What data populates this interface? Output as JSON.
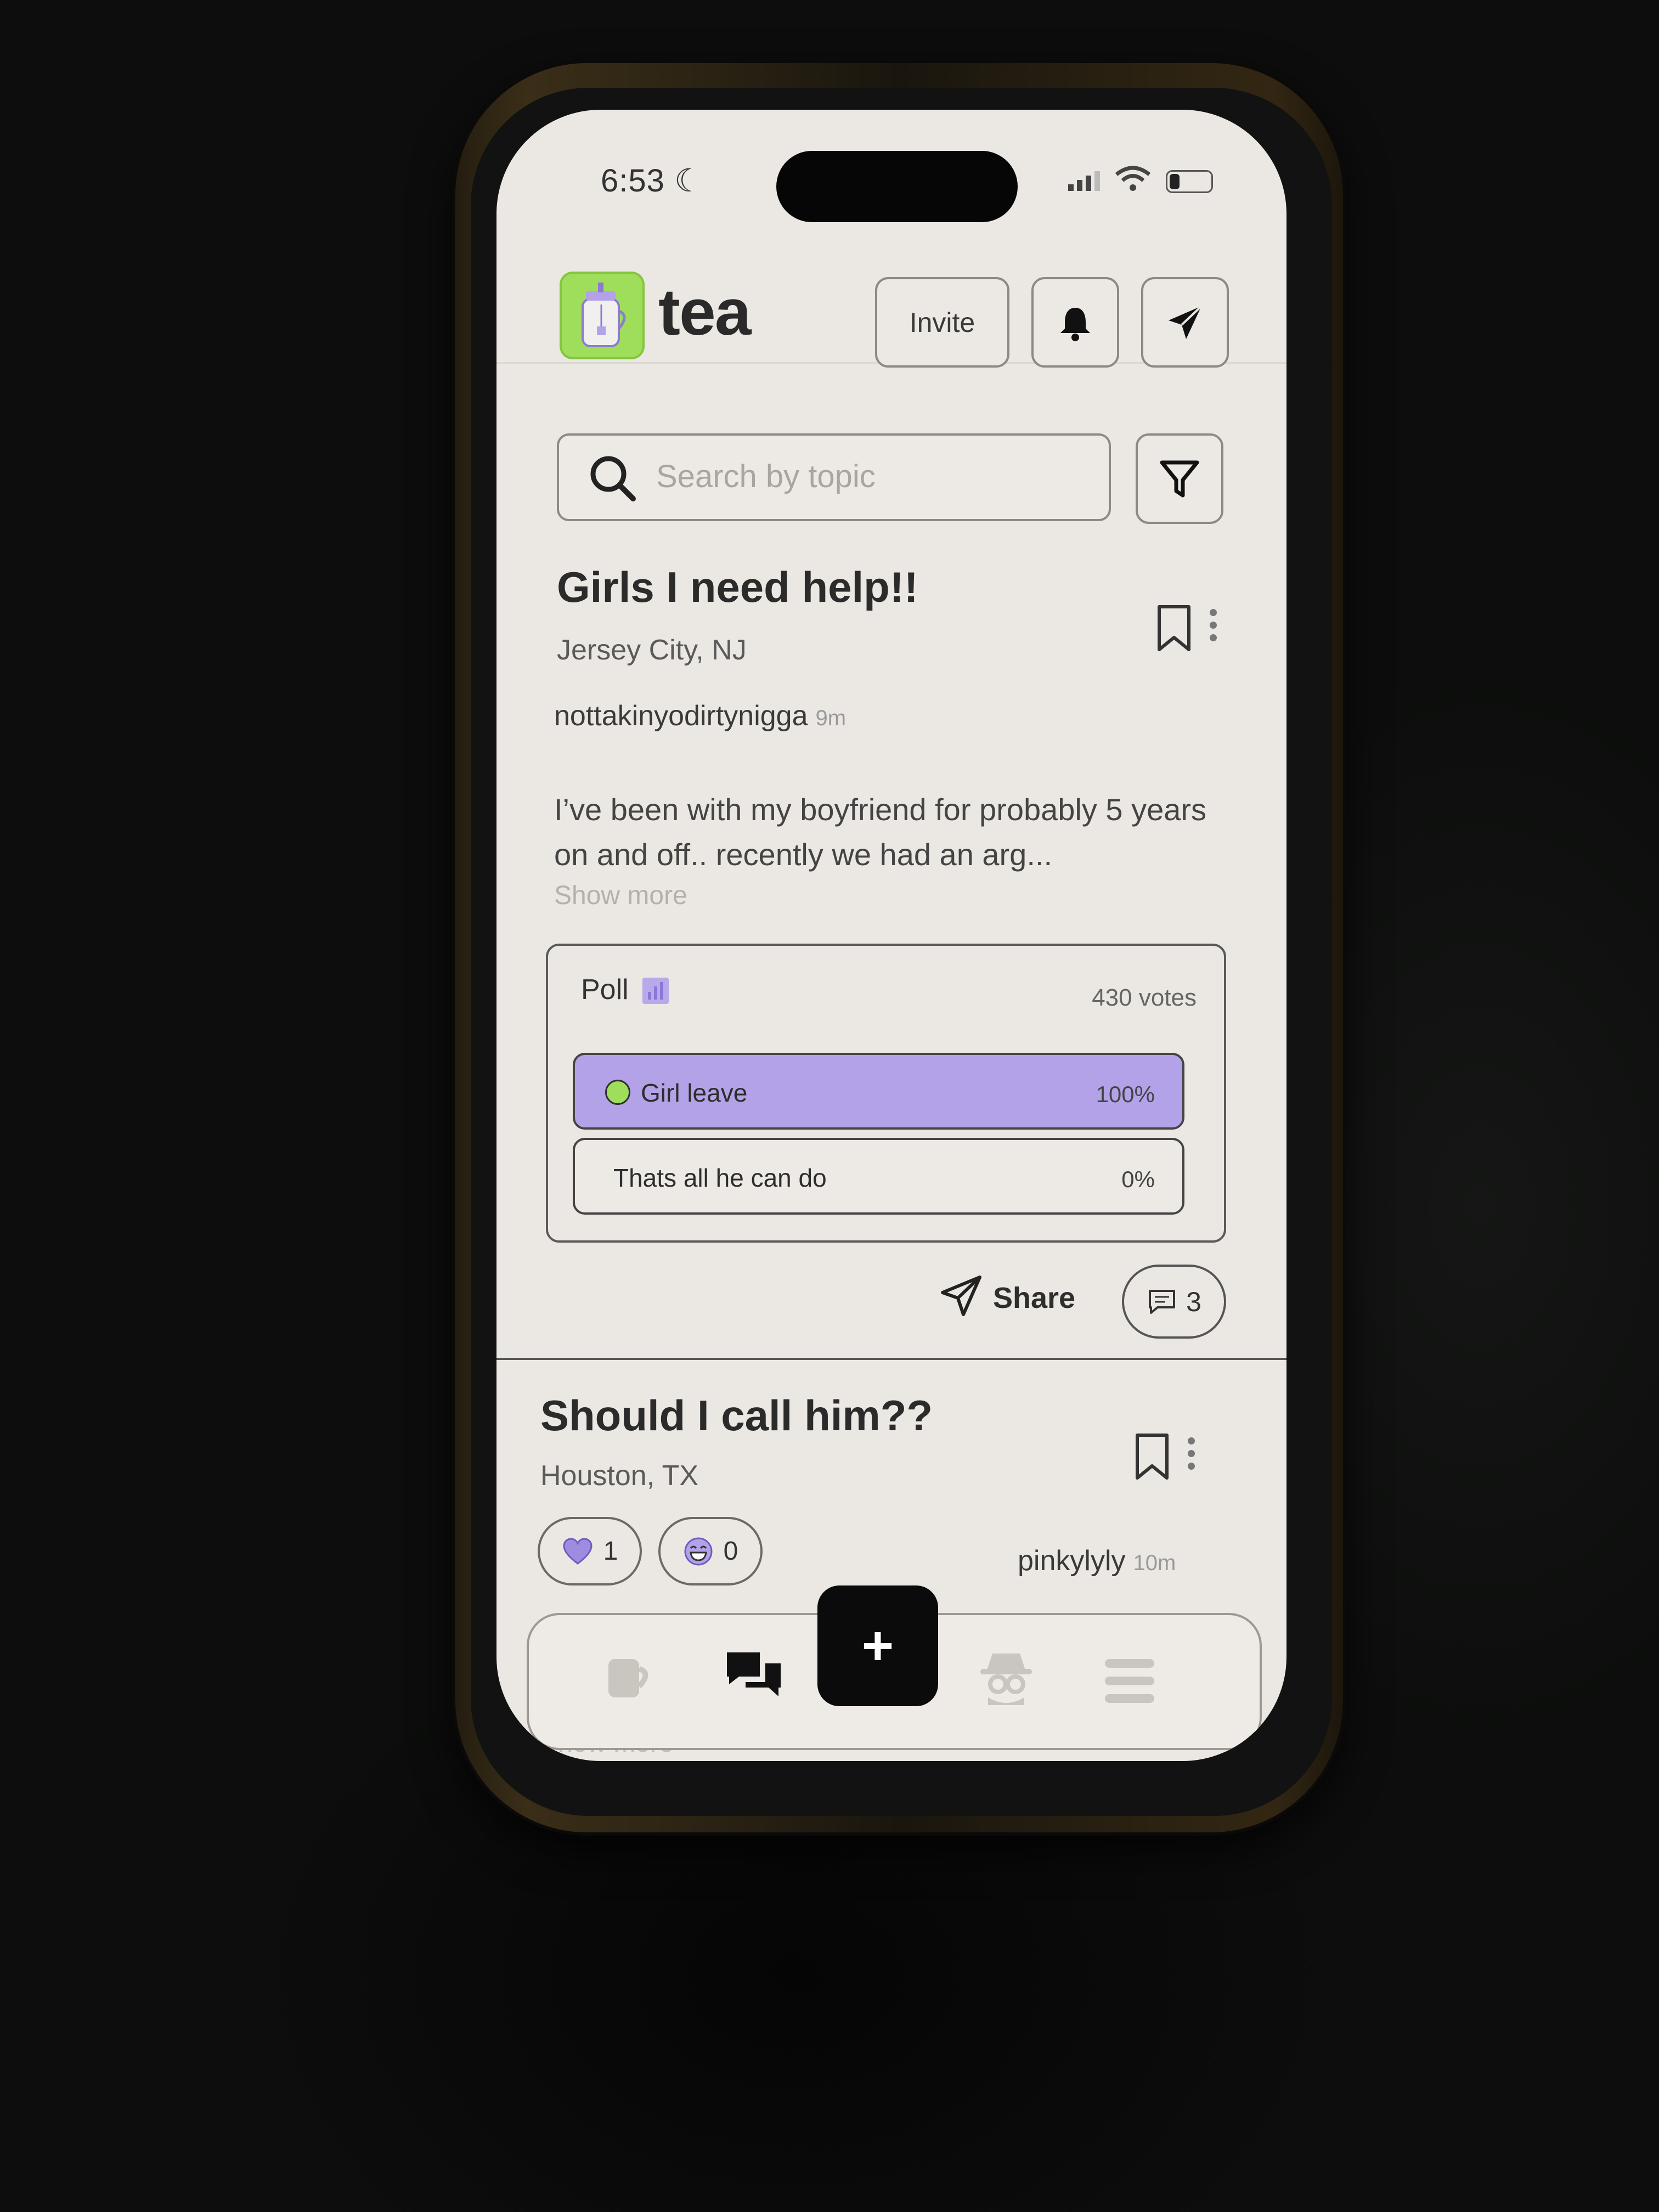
{
  "status_bar": {
    "time": "6:53"
  },
  "header": {
    "app_name": "tea",
    "invite_label": "Invite"
  },
  "search": {
    "placeholder": "Search by topic"
  },
  "posts": [
    {
      "title": "Girls I need help!!",
      "location": "Jersey City, NJ",
      "username": "nottakinyodirtynigga",
      "time_ago": "9m",
      "body": "I’ve been with my boyfriend for probably 5 years on and off.. recently we had an arg...",
      "show_more": "Show more",
      "poll": {
        "label": "Poll",
        "votes": "430 votes",
        "options": [
          {
            "label": "Girl leave",
            "percent": "100%",
            "selected": true
          },
          {
            "label": "Thats all he can do",
            "percent": "0%",
            "selected": false
          }
        ]
      },
      "share_label": "Share",
      "comment_count": "3"
    },
    {
      "title": "Should I call him??",
      "location": "Houston, TX",
      "username": "pinkylyly",
      "time_ago": "10m",
      "like_count": "1",
      "laugh_count": "0",
      "show_more": "Show more"
    }
  ],
  "bottom_nav": {
    "items": [
      "tea-cup-icon",
      "chat-icon",
      "add-icon",
      "detective-icon",
      "menu-icon"
    ],
    "fab_label": "+",
    "active": "chat-icon"
  },
  "colors": {
    "brand_green": "#9ede5b",
    "accent_purple": "#b3a2e8",
    "screen_bg": "#ebe8e3"
  }
}
